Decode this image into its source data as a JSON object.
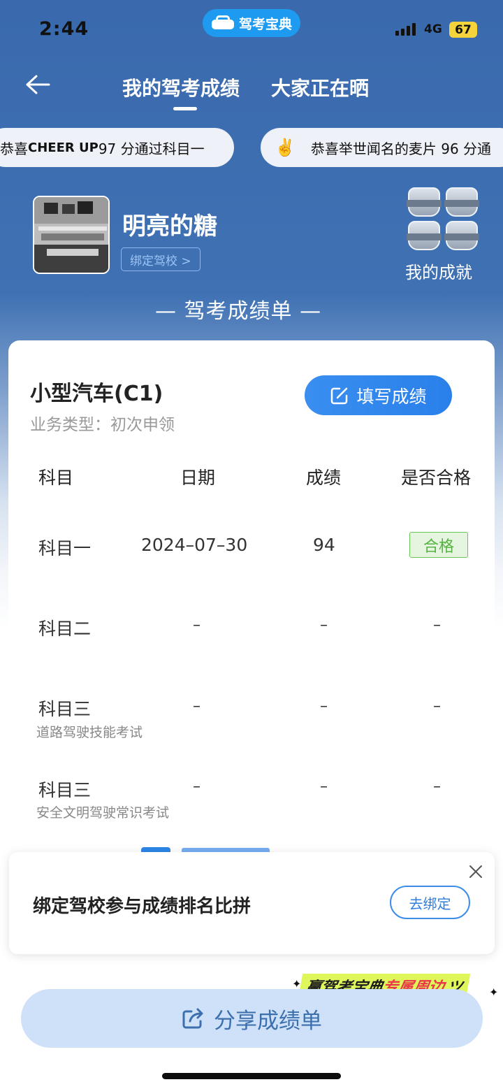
{
  "status_bar": {
    "time": "2:44",
    "network": "4G",
    "battery": "67"
  },
  "app_pill": {
    "label": "驾考宝典",
    "icon": "car-icon"
  },
  "header": {
    "back_icon": "arrow-left-icon",
    "tabs": [
      {
        "label": "我的驾考成绩",
        "active": true
      },
      {
        "label": "大家正在晒",
        "active": false
      }
    ]
  },
  "ticker": {
    "items": [
      {
        "prefix": "恭喜",
        "name": "CHEER UP",
        "text": "97 分通过科目一"
      },
      {
        "emoji": "✌️",
        "text": "恭喜举世闻名的麦片 96 分通"
      }
    ]
  },
  "profile": {
    "username": "明亮的糖",
    "bind_school": "绑定驾校 >",
    "achievements_label": "我的成就"
  },
  "section_title": "— 驾考成绩单 —",
  "card": {
    "car_type": "小型汽车(C1)",
    "business_type": "业务类型：初次申领",
    "fill_button": "填写成绩",
    "columns": [
      "科目",
      "日期",
      "成绩",
      "是否合格"
    ],
    "rows": [
      {
        "subject": "科目一",
        "sub": "",
        "date": "2024–07–30",
        "score": "94",
        "passed": "合格"
      },
      {
        "subject": "科目二",
        "sub": "",
        "date": "–",
        "score": "–",
        "passed": "–"
      },
      {
        "subject": "科目三",
        "sub": "道路驾驶技能考试",
        "date": "–",
        "score": "–",
        "passed": "–"
      },
      {
        "subject": "科目三",
        "sub": "安全文明驾驶常识考试",
        "date": "–",
        "score": "–",
        "passed": "–"
      }
    ]
  },
  "popup": {
    "text": "绑定驾校参与成绩排名比拼",
    "button": "去绑定",
    "close_icon": "close-icon"
  },
  "promo": {
    "part1": "赢驾考宝典",
    "part2": "专属周边",
    "part3": "ツ"
  },
  "share_button": {
    "label": "分享成绩单",
    "icon": "share-icon"
  },
  "colors": {
    "header_blue": "#3f71b3",
    "primary_button": "#2a80ea",
    "pass_green": "#55b342",
    "promo_yellow": "#dff75a"
  }
}
